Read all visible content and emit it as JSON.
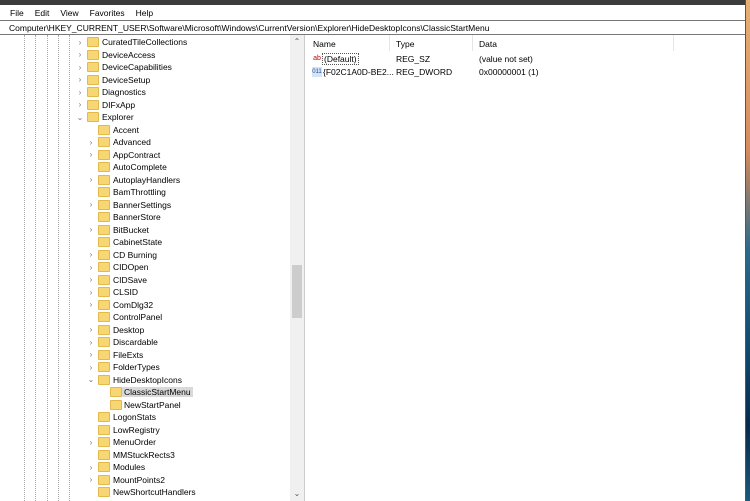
{
  "menu": [
    "File",
    "Edit",
    "View",
    "Favorites",
    "Help"
  ],
  "address": "Computer\\HKEY_CURRENT_USER\\Software\\Microsoft\\Windows\\CurrentVersion\\Explorer\\HideDesktopIcons\\ClassicStartMenu",
  "tree": [
    {
      "label": "CuratedTileCollections",
      "level": 1,
      "exp": ">"
    },
    {
      "label": "DeviceAccess",
      "level": 1,
      "exp": ">"
    },
    {
      "label": "DeviceCapabilities",
      "level": 1,
      "exp": ">"
    },
    {
      "label": "DeviceSetup",
      "level": 1,
      "exp": ">"
    },
    {
      "label": "Diagnostics",
      "level": 1,
      "exp": ">"
    },
    {
      "label": "DIFxApp",
      "level": 1,
      "exp": ">"
    },
    {
      "label": "Explorer",
      "level": 1,
      "exp": "v"
    },
    {
      "label": "Accent",
      "level": 2,
      "exp": ""
    },
    {
      "label": "Advanced",
      "level": 2,
      "exp": ">"
    },
    {
      "label": "AppContract",
      "level": 2,
      "exp": ">"
    },
    {
      "label": "AutoComplete",
      "level": 2,
      "exp": ""
    },
    {
      "label": "AutoplayHandlers",
      "level": 2,
      "exp": ">"
    },
    {
      "label": "BamThrottling",
      "level": 2,
      "exp": ""
    },
    {
      "label": "BannerSettings",
      "level": 2,
      "exp": ">"
    },
    {
      "label": "BannerStore",
      "level": 2,
      "exp": ""
    },
    {
      "label": "BitBucket",
      "level": 2,
      "exp": ">"
    },
    {
      "label": "CabinetState",
      "level": 2,
      "exp": ""
    },
    {
      "label": "CD Burning",
      "level": 2,
      "exp": ">"
    },
    {
      "label": "CIDOpen",
      "level": 2,
      "exp": ">"
    },
    {
      "label": "CIDSave",
      "level": 2,
      "exp": ">"
    },
    {
      "label": "CLSID",
      "level": 2,
      "exp": ">"
    },
    {
      "label": "ComDlg32",
      "level": 2,
      "exp": ">"
    },
    {
      "label": "ControlPanel",
      "level": 2,
      "exp": ""
    },
    {
      "label": "Desktop",
      "level": 2,
      "exp": ">"
    },
    {
      "label": "Discardable",
      "level": 2,
      "exp": ">"
    },
    {
      "label": "FileExts",
      "level": 2,
      "exp": ">"
    },
    {
      "label": "FolderTypes",
      "level": 2,
      "exp": ">"
    },
    {
      "label": "HideDesktopIcons",
      "level": 2,
      "exp": "v"
    },
    {
      "label": "ClassicStartMenu",
      "level": 3,
      "exp": "",
      "selected": true
    },
    {
      "label": "NewStartPanel",
      "level": 3,
      "exp": ""
    },
    {
      "label": "LogonStats",
      "level": 2,
      "exp": ""
    },
    {
      "label": "LowRegistry",
      "level": 2,
      "exp": ""
    },
    {
      "label": "MenuOrder",
      "level": 2,
      "exp": ">"
    },
    {
      "label": "MMStuckRects3",
      "level": 2,
      "exp": ""
    },
    {
      "label": "Modules",
      "level": 2,
      "exp": ">"
    },
    {
      "label": "MountPoints2",
      "level": 2,
      "exp": ">"
    },
    {
      "label": "NewShortcutHandlers",
      "level": 2,
      "exp": ""
    }
  ],
  "columns": {
    "name": "Name",
    "type": "Type",
    "data": "Data"
  },
  "values": [
    {
      "icon": "ab",
      "name": "(Default)",
      "type": "REG_SZ",
      "data": "(value not set)"
    },
    {
      "icon": "011",
      "name": "{F02C1A0D-BE2...",
      "type": "REG_DWORD",
      "data": "0x00000001 (1)"
    }
  ]
}
